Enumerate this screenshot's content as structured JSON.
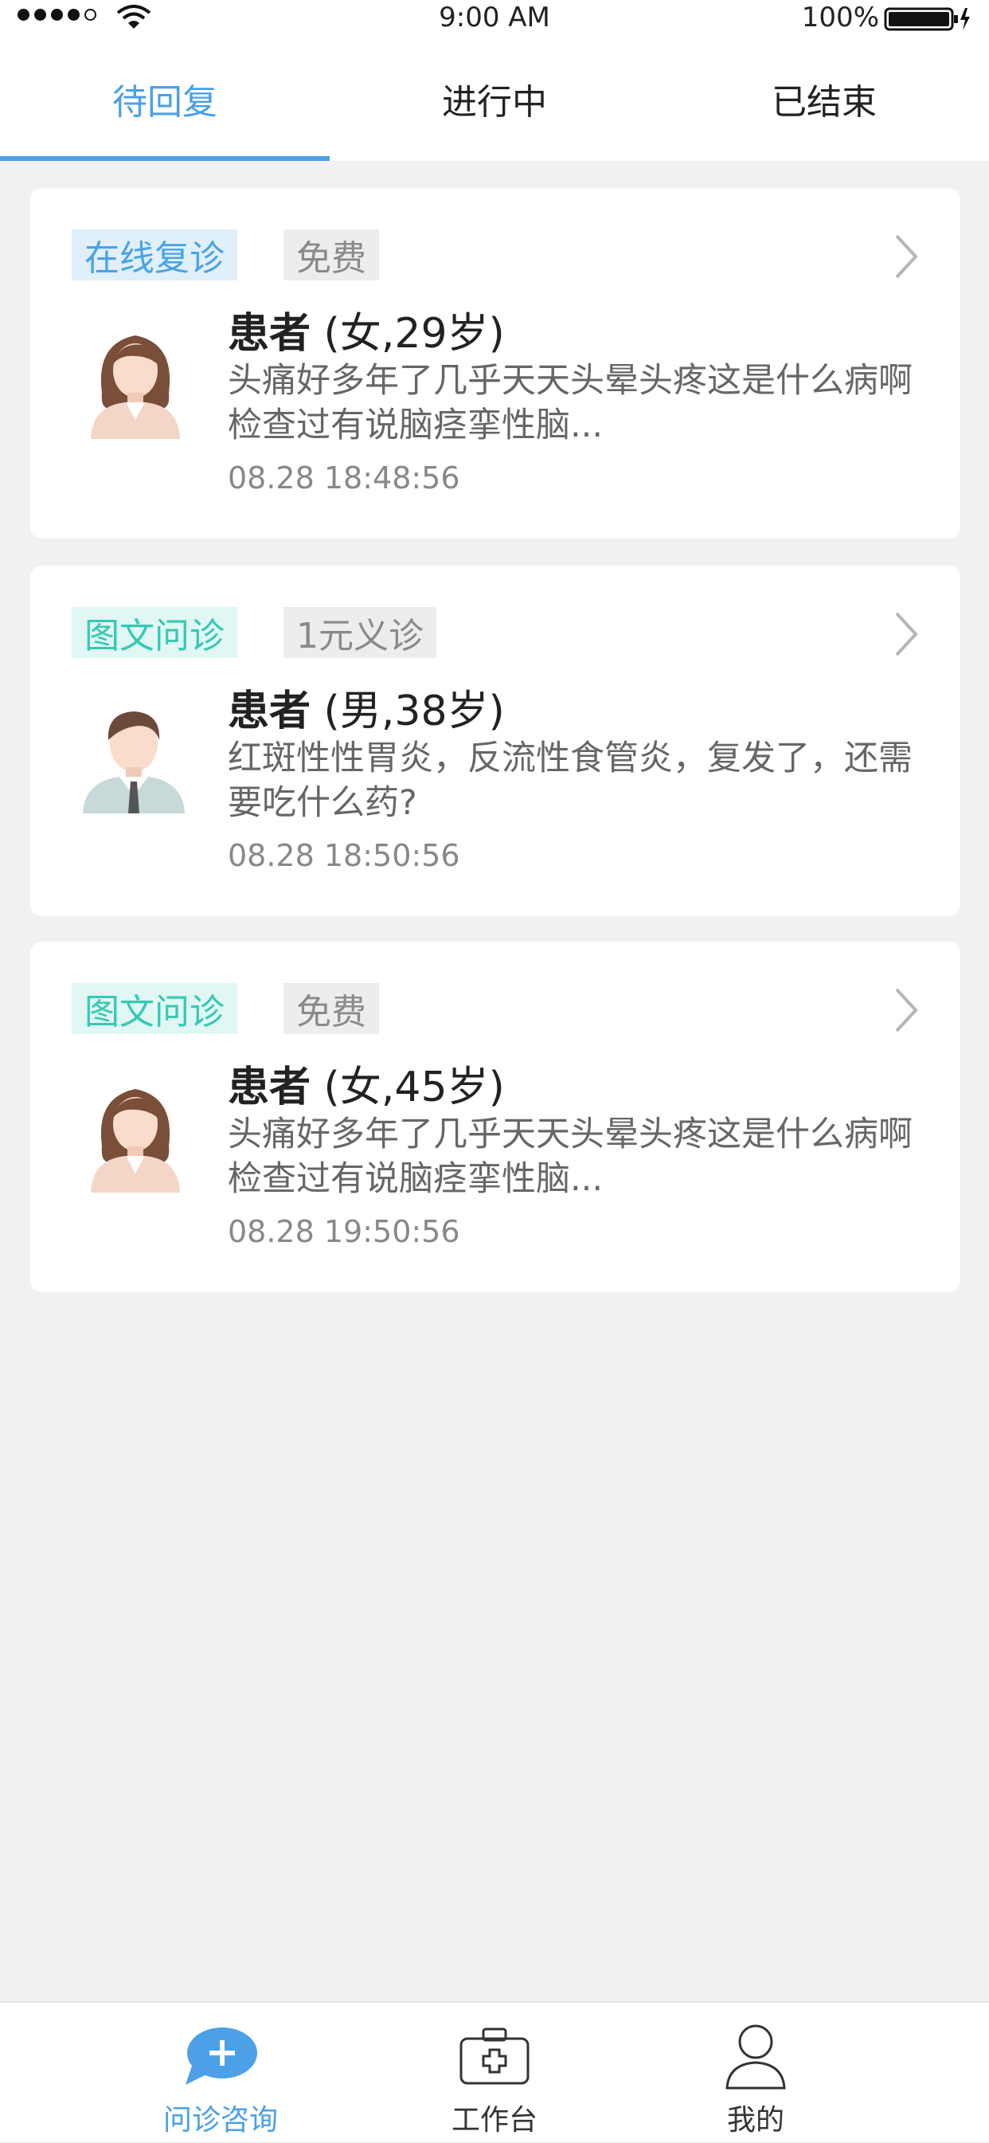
{
  "status_bar": {
    "time": "9:00 AM",
    "battery": "100%"
  },
  "tabs": [
    {
      "label": "待回复",
      "active": true
    },
    {
      "label": "进行中",
      "active": false
    },
    {
      "label": "已结束",
      "active": false
    }
  ],
  "consultations": [
    {
      "type_tag": "在线复诊",
      "type_color": "#48a3e6",
      "price_tag": "免费",
      "patient_label": "患者",
      "patient_info": "(女,29岁)",
      "message": "头痛好多年了几乎天天头晕头疼这是什么病啊检查过有说脑痉挛性脑...",
      "time": "08.28 18:48:56",
      "avatar": "female-avatar-icon"
    },
    {
      "type_tag": "图文问诊",
      "type_color": "#35c9b3",
      "price_tag": "1元义诊",
      "patient_label": "患者",
      "patient_info": "(男,38岁)",
      "message": "红斑性性胃炎，反流性食管炎，复发了，还需要吃什么药?",
      "time": "08.28 18:50:56",
      "avatar": "male-avatar-icon"
    },
    {
      "type_tag": "图文问诊",
      "type_color": "#35c9b3",
      "price_tag": "免费",
      "patient_label": "患者",
      "patient_info": "(女,45岁)",
      "message": "头痛好多年了几乎天天头晕头疼这是什么病啊检查过有说脑痉挛性脑...",
      "time": "08.28 19:50:56",
      "avatar": "female-avatar-icon"
    }
  ],
  "bottom_nav": [
    {
      "label": "问诊咨询",
      "icon": "chat-plus-icon",
      "active": true
    },
    {
      "label": "工作台",
      "icon": "medical-kit-icon",
      "active": false
    },
    {
      "label": "我的",
      "icon": "user-icon",
      "active": false
    }
  ],
  "colors": {
    "accent": "#4ba0e6",
    "teal": "#35c9b3",
    "background": "#f1f1f1"
  }
}
